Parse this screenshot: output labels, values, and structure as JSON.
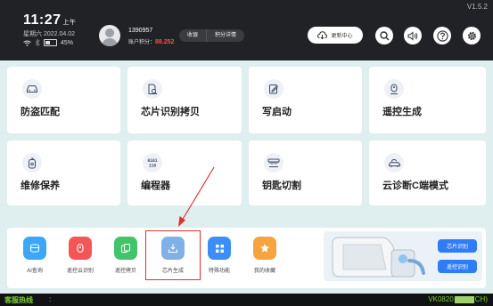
{
  "version": "V1.5.2",
  "time": "11:27",
  "ampm": "上午",
  "date": "星期六 2022.04.02",
  "battery_label": "45%",
  "battery_level": 0.45,
  "account": "1390957",
  "points_label": "账户积分：",
  "points_value": "88.252",
  "pill_buttons": [
    "收银",
    "积分详情"
  ],
  "update_label": "更新中心",
  "icons_top": [
    "search-icon",
    "volume-icon",
    "help-icon",
    "settings-icon"
  ],
  "cards": [
    {
      "label": "防盗匹配",
      "icon": "car-icon"
    },
    {
      "label": "芯片识别拷贝",
      "icon": "chip-search-icon"
    },
    {
      "label": "写启动",
      "icon": "write-icon"
    },
    {
      "label": "遥控生成",
      "icon": "remote-icon"
    },
    {
      "label": "维修保养",
      "icon": "oil-icon"
    },
    {
      "label": "编程器",
      "icon": "binary-icon"
    },
    {
      "label": "钥匙切割",
      "icon": "key-cut-icon"
    },
    {
      "label": "云诊断C端模式",
      "icon": "cloud-car-icon"
    }
  ],
  "quick_actions": [
    {
      "label": "AI查询",
      "color": "#3ba7f6"
    },
    {
      "label": "遥控云识别",
      "color": "#f25656"
    },
    {
      "label": "遥控拷贝",
      "color": "#42c46a"
    },
    {
      "label": "芯片生成",
      "color": "#7fb0e8"
    },
    {
      "label": "特殊功能",
      "color": "#3a8ef6"
    },
    {
      "label": "我的收藏",
      "color": "#f7a440"
    }
  ],
  "promo_buttons": [
    "芯片识别",
    "遥控识别"
  ],
  "footer": {
    "hotline": "客服热线",
    "dot": ":",
    "vk_left": "VK0820",
    "vk_right": "CH)"
  },
  "colors": {
    "accent": "#2f7df6",
    "highlight": "#e03030",
    "hotline": "#7ecf3a"
  }
}
